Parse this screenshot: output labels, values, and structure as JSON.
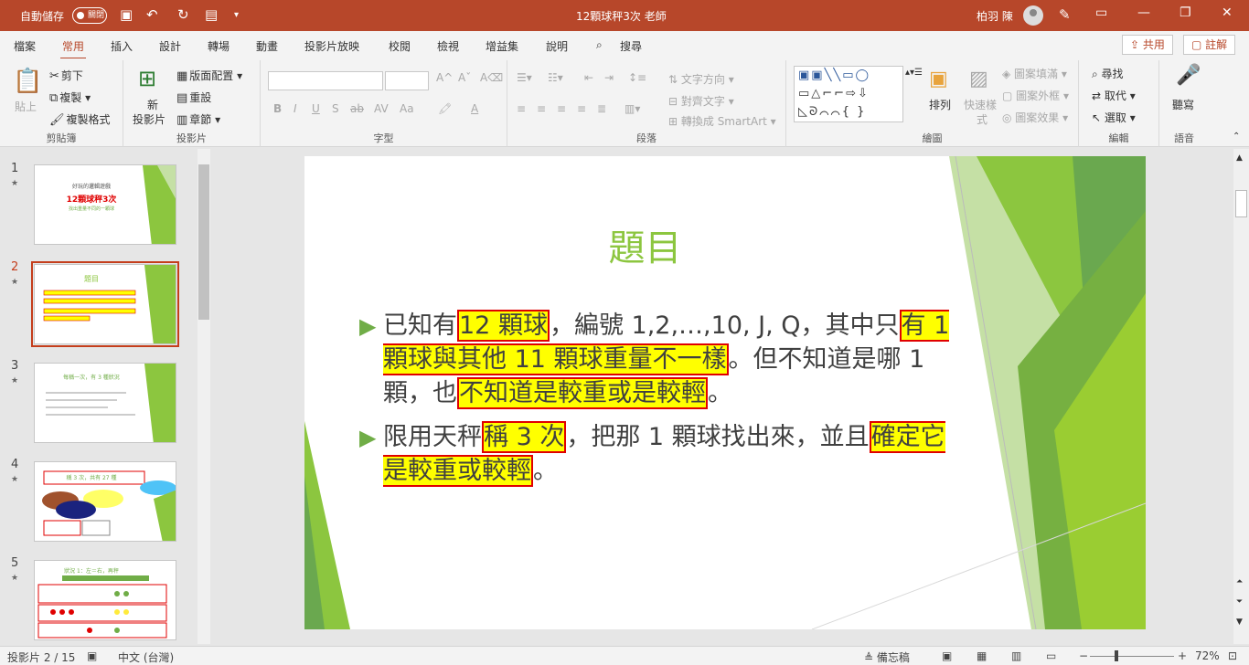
{
  "window": {
    "autosave_label": "自動儲存",
    "autosave_state": "關閉",
    "title": "12顆球秤3次 老師",
    "user_name": "柏羽 陳"
  },
  "tabs": [
    "檔案",
    "常用",
    "插入",
    "設計",
    "轉場",
    "動畫",
    "投影片放映",
    "校閱",
    "檢視",
    "增益集",
    "說明",
    "搜尋"
  ],
  "share_label": "共用",
  "comment_label": "註解",
  "ribbon": {
    "clipboard": {
      "paste": "貼上",
      "cut": "剪下",
      "copy": "複製",
      "format_painter": "複製格式",
      "label": "剪貼簿"
    },
    "slides": {
      "new_slide_1": "新",
      "new_slide_2": "投影片",
      "layout": "版面配置",
      "reset": "重設",
      "section": "章節",
      "label": "投影片"
    },
    "font": {
      "label": "字型"
    },
    "paragraph": {
      "text_direction": "文字方向",
      "align_text": "對齊文字",
      "smartart": "轉換成 SmartArt",
      "label": "段落"
    },
    "drawing": {
      "arrange": "排列",
      "quick_styles_1": "快速樣",
      "quick_styles_2": "式",
      "fill": "圖案填滿",
      "outline": "圖案外框",
      "effects": "圖案效果",
      "label": "繪圖"
    },
    "editing": {
      "find": "尋找",
      "replace": "取代",
      "select": "選取",
      "label": "編輯"
    },
    "voice": {
      "dictate": "聽寫",
      "label": "語音"
    }
  },
  "thumbnails": [
    {
      "num": "1",
      "title": "好玩的邏輯遊戲",
      "subtitle": "12顆球秤3次",
      "caption": "找出重量不同的一顆球"
    },
    {
      "num": "2",
      "title": "題目"
    },
    {
      "num": "3",
      "title": "每稱一次，有 3 種狀況"
    },
    {
      "num": "4",
      "title": "稱 3 次，共有 27 種"
    },
    {
      "num": "5",
      "title": "狀況 1：左＝右，再秤"
    }
  ],
  "slide": {
    "title": "題目",
    "b1_a": "已知有",
    "b1_hl1": "12 顆球",
    "b1_b": "，編號 1,2,…,10, J, Q，其中只",
    "b1_hl2": "有 1 顆球與其他 11 顆球重量不一樣",
    "b1_c": "。但不知道是哪 1 顆，也",
    "b1_hl3": "不知道是較重或是較輕",
    "b1_d": "。",
    "b2_a": "限用天秤",
    "b2_hl1": "稱 3 次",
    "b2_b": "，把那 1 顆球找出來，並且",
    "b2_hl2": "確定它是較重或較輕",
    "b2_c": "。"
  },
  "status": {
    "slide_pos": "投影片 2 / 15",
    "language": "中文 (台灣)",
    "notes": "備忘稿",
    "zoom": "72%"
  },
  "colors": {
    "accent": "#b7472a",
    "slide_green": "#8cc63f",
    "highlight": "#ffff00",
    "highlight_border": "#e00000"
  }
}
